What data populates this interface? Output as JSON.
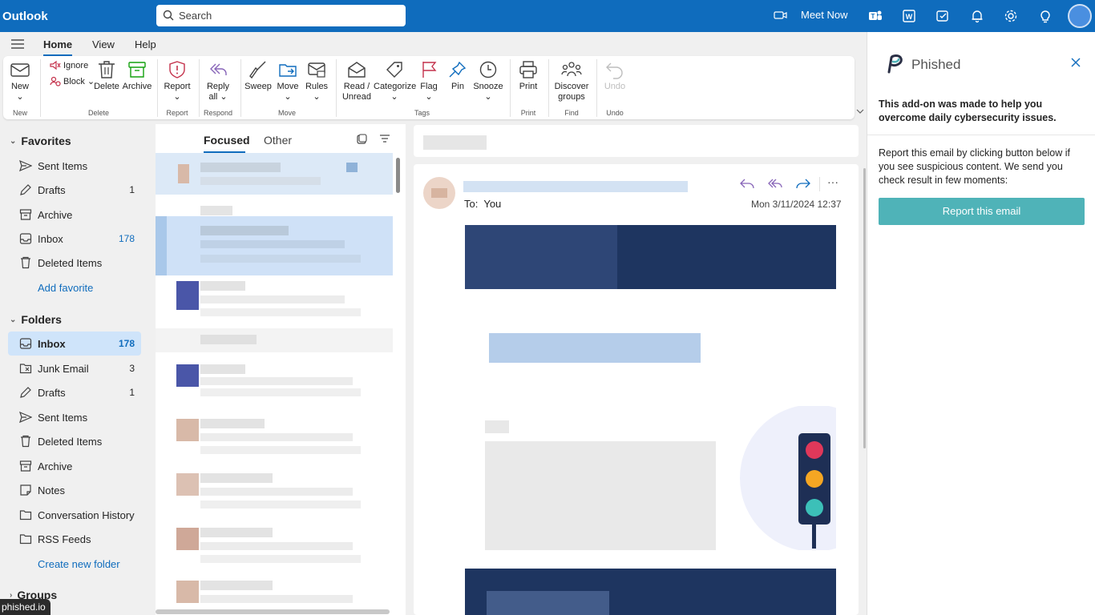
{
  "app": {
    "title": "Outlook"
  },
  "search": {
    "placeholder": "Search"
  },
  "topbar": {
    "meet_now": "Meet Now"
  },
  "menu": {
    "tabs": [
      "Home",
      "View",
      "Help"
    ]
  },
  "ribbon": {
    "new": "New",
    "ignore": "Ignore",
    "block": "Block",
    "delete": "Delete",
    "archive": "Archive",
    "report": "Report",
    "reply_all_1": "Reply",
    "reply_all_2": "all",
    "sweep": "Sweep",
    "move": "Move",
    "rules": "Rules",
    "read_unread_1": "Read /",
    "read_unread_2": "Unread",
    "categorize": "Categorize",
    "flag": "Flag",
    "pin": "Pin",
    "snooze": "Snooze",
    "print": "Print",
    "discover_1": "Discover",
    "discover_2": "groups",
    "undo": "Undo",
    "groups": {
      "new": "New",
      "delete": "Delete",
      "report": "Report",
      "respond": "Respond",
      "move": "Move",
      "tags": "Tags",
      "print": "Print",
      "find": "Find",
      "undo": "Undo"
    }
  },
  "nav": {
    "favorites_label": "Favorites",
    "favorites": [
      {
        "label": "Sent Items",
        "count": ""
      },
      {
        "label": "Drafts",
        "count": "1"
      },
      {
        "label": "Archive",
        "count": ""
      },
      {
        "label": "Inbox",
        "count": "178"
      },
      {
        "label": "Deleted Items",
        "count": ""
      }
    ],
    "add_favorite": "Add favorite",
    "folders_label": "Folders",
    "folders": [
      {
        "label": "Inbox",
        "count": "178"
      },
      {
        "label": "Junk Email",
        "count": "3"
      },
      {
        "label": "Drafts",
        "count": "1"
      },
      {
        "label": "Sent Items",
        "count": ""
      },
      {
        "label": "Deleted Items",
        "count": ""
      },
      {
        "label": "Archive",
        "count": ""
      },
      {
        "label": "Notes",
        "count": ""
      },
      {
        "label": "Conversation History",
        "count": ""
      },
      {
        "label": "RSS Feeds",
        "count": ""
      }
    ],
    "create_folder": "Create new folder",
    "groups_label": "Groups"
  },
  "list": {
    "tabs": [
      "Focused",
      "Other"
    ]
  },
  "message": {
    "to_label": "To:",
    "to_value": "You",
    "date": "Mon 3/11/2024 12:37"
  },
  "addin": {
    "name": "Phished",
    "intro": "This add-on was made to help you overcome daily cybersecurity issues.",
    "instructions": "Report this email by clicking button below if you see suspicious content. We send you check result in few moments:",
    "button": "Report this email",
    "accent": "#4fb3b8"
  },
  "status_bar": {
    "text": "phished.io"
  },
  "colors": {
    "topbar": "#0f6cbd",
    "selected": "#cfe4fa",
    "email_banner": "#1e3560"
  }
}
